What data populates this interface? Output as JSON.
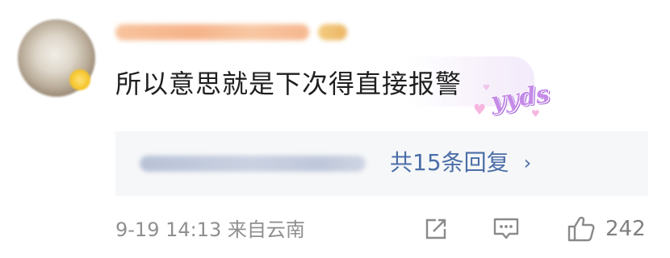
{
  "comment": {
    "username": "",
    "text": "所以意思就是下次得直接报警",
    "sticker_text": "yyds"
  },
  "replies": {
    "preview": "",
    "link_label": "共15条回复",
    "chevron": "›"
  },
  "meta": {
    "datetime": "9-19 14:13",
    "location": "来自云南",
    "like_count": "242"
  },
  "icons": [
    "share-icon",
    "comment-icon",
    "thumbs-up-icon",
    "chevron-right-icon"
  ],
  "colors": {
    "link": "#4a6ea6",
    "meta_text": "#8f8f8f",
    "replies_bg": "#f6f7f9",
    "sticker": "#c58be8"
  }
}
